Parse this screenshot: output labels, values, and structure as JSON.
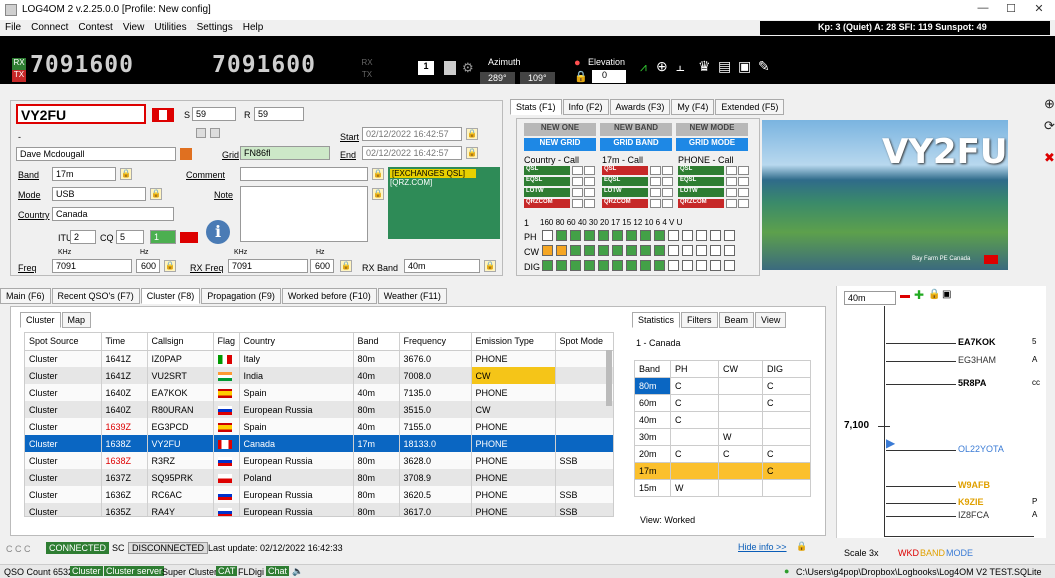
{
  "window": {
    "title": "LOG4OM 2 v.2.25.0.0 [Profile: New config]",
    "min": "—",
    "max": "☐",
    "close": "✕"
  },
  "menu": [
    "File",
    "Connect",
    "Contest",
    "View",
    "Utilities",
    "Settings",
    "Help"
  ],
  "kp": "Kp: 3 (Quiet) A: 28 SFI: 119 Sunspot: 49",
  "radio": {
    "rx": "RX",
    "tx": "TX",
    "freq1": "7091600",
    "freq2": "7091600",
    "rx2": "RX",
    "tx2": "TX",
    "mem": "1",
    "azimuth_label": "Azimuth",
    "az1": "289°",
    "az2": "109°",
    "elevation_label": "Elevation",
    "elev": "0"
  },
  "qso": {
    "callsign": "VY2FU",
    "name": "-",
    "fullname": "Dave Mcdougall",
    "s": "S",
    "s_val": "59",
    "r": "R",
    "r_val": "59",
    "start_label": "Start",
    "start": "02/12/2022 16:42:57",
    "end_label": "End",
    "end": "02/12/2022 16:42:57",
    "grid_label": "Grid",
    "grid": "FN86fl",
    "band_label": "Band",
    "band": "17m",
    "mode_label": "Mode",
    "mode": "USB",
    "country_label": "Country",
    "country": "Canada",
    "comment_label": "Comment",
    "note_label": "Note",
    "itu_label": "ITU",
    "itu": "2",
    "cq_label": "CQ",
    "cq": "5",
    "num": "1",
    "freq_label": "Freq",
    "freq": "7091",
    "freq_khz": "KHz",
    "freq_hz": "600",
    "hz": "Hz",
    "rxfreq_label": "RX Freq",
    "rxfreq": "7091",
    "rxhz": "600",
    "rxband_label": "RX Band",
    "rxband": "40m",
    "exch": "[EXCHANGES QSL]",
    "qrz": "[QRZ.COM]"
  },
  "stats_tabs": [
    "Stats (F1)",
    "Info (F2)",
    "Awards (F3)",
    "My (F4)",
    "Extended (F5)"
  ],
  "stats": {
    "new_one": "NEW ONE",
    "new_band": "NEW BAND",
    "new_mode": "NEW MODE",
    "new_grid": "NEW GRID",
    "grid_band": "GRID BAND",
    "grid_mode": "GRID MODE",
    "col1": "Country - Call",
    "col2": "17m - Call",
    "col3": "PHONE - Call",
    "qsl": "QSL",
    "eqsl": "EQSL",
    "lotw": "LOTW",
    "qrzcom": "QRZCOM",
    "one": "1",
    "bands": "160 80 60 40 30 20 17 15 12 10  6  4  V  U",
    "ph": "PH",
    "cw": "CW",
    "dig": "DIG"
  },
  "photo": {
    "callsign": "VY2FU",
    "caption": "Bay Farm PE Canada"
  },
  "main_tabs": [
    "Main (F6)",
    "Recent QSO's (F7)",
    "Cluster (F8)",
    "Propagation (F9)",
    "Worked before (F10)",
    "Weather (F11)"
  ],
  "cluster_tabs": [
    "Cluster",
    "Map"
  ],
  "cluster_cols": [
    "Spot Source",
    "Time",
    "Callsign",
    "Flag",
    "Country",
    "Band",
    "Frequency",
    "Emission Type",
    "Spot Mode"
  ],
  "cluster_rows": [
    [
      "Cluster",
      "1641Z",
      "IZ0PAP",
      "Italy",
      "80m",
      "3676.0",
      "PHONE",
      ""
    ],
    [
      "Cluster",
      "1641Z",
      "VU2SRT",
      "India",
      "40m",
      "7008.0",
      "CW",
      ""
    ],
    [
      "Cluster",
      "1640Z",
      "EA7KOK",
      "Spain",
      "40m",
      "7135.0",
      "PHONE",
      ""
    ],
    [
      "Cluster",
      "1640Z",
      "R80URAN",
      "European Russia",
      "80m",
      "3515.0",
      "CW",
      ""
    ],
    [
      "Cluster",
      "1639Z",
      "EG3PCD",
      "Spain",
      "40m",
      "7155.0",
      "PHONE",
      ""
    ],
    [
      "Cluster",
      "1638Z",
      "VY2FU",
      "Canada",
      "17m",
      "18133.0",
      "PHONE",
      ""
    ],
    [
      "Cluster",
      "1638Z",
      "R3RZ",
      "European Russia",
      "80m",
      "3628.0",
      "PHONE",
      "SSB"
    ],
    [
      "Cluster",
      "1637Z",
      "SQ95PRK",
      "Poland",
      "80m",
      "3708.9",
      "PHONE",
      ""
    ],
    [
      "Cluster",
      "1636Z",
      "RC6AC",
      "European Russia",
      "80m",
      "3620.5",
      "PHONE",
      "SSB"
    ],
    [
      "Cluster",
      "1635Z",
      "RA4Y",
      "European Russia",
      "80m",
      "3617.0",
      "PHONE",
      "SSB"
    ]
  ],
  "stat_tabs": [
    "Statistics",
    "Filters",
    "Beam",
    "View"
  ],
  "stat_title": "1 - Canada",
  "stat_cols": [
    "Band",
    "PH",
    "CW",
    "DIG"
  ],
  "stat_rows": [
    [
      "80m",
      "C",
      "",
      "C"
    ],
    [
      "60m",
      "C",
      "",
      "C"
    ],
    [
      "40m",
      "C",
      "",
      ""
    ],
    [
      "30m",
      "",
      "W",
      ""
    ],
    [
      "20m",
      "C",
      "C",
      "C"
    ],
    [
      "17m",
      "",
      "",
      "C"
    ],
    [
      "15m",
      "W",
      "",
      ""
    ]
  ],
  "stat_view": "View: Worked",
  "bandmap": {
    "band": "40m",
    "freq": "7,100",
    "scale": "Scale 3x",
    "wkd": "WKD",
    "bandl": "BAND",
    "model": "MODE",
    "spots": [
      [
        "EA7KOK",
        "5"
      ],
      [
        "EG3HAM",
        "A"
      ],
      [
        "5R8PA",
        "cc"
      ],
      [
        "OL22YOTA",
        ""
      ],
      [
        "W9AFB",
        ""
      ],
      [
        "K9ZIE",
        "P"
      ],
      [
        "IZ8FCA",
        "A"
      ]
    ]
  },
  "status": {
    "ccc": "C C C",
    "connected": "CONNECTED",
    "sc": "SC",
    "disconnected": "DISCONNECTED",
    "update": "Last update: 02/12/2022 16:42:33",
    "hide": "Hide info >>"
  },
  "footer": {
    "count": "QSO Count 6532",
    "cluster": "Cluster",
    "server": "Cluster server",
    "super": "Super Cluster",
    "cat": "CAT",
    "fldigi": "FLDigi",
    "chat": "Chat",
    "path": "C:\\Users\\g4pop\\Dropbox\\Logbooks\\Log4OM V2 TEST.SQLite"
  }
}
